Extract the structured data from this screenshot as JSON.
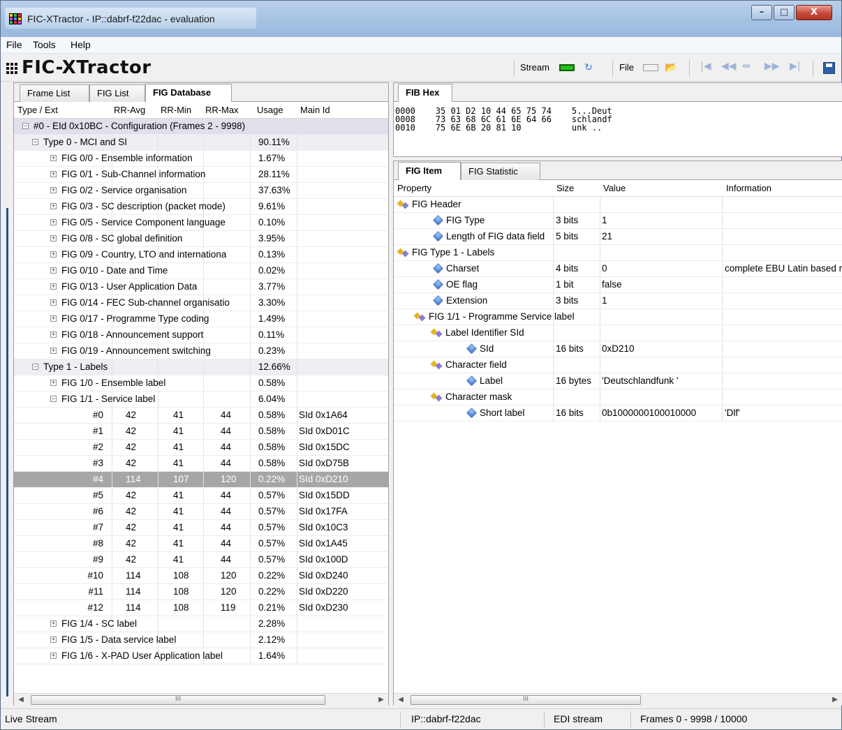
{
  "window": {
    "title": "FIC-XTractor - IP::dabrf-f22dac - evaluation"
  },
  "menu": [
    "File",
    "Tools",
    "Help"
  ],
  "toolbar": {
    "brand": "FIC-XTractor",
    "stream_label": "Stream",
    "file_label": "File"
  },
  "left_tabs": [
    "Frame List",
    "FIG List",
    "FIG Database"
  ],
  "left_columns": [
    "Type / Ext",
    "RR-Avg",
    "RR-Min",
    "RR-Max",
    "Usage",
    "Main Id"
  ],
  "left_rows": [
    {
      "indent": 0,
      "exp": "−",
      "label": "#0 - EId 0x10BC - Configuration (Frames 2 - 9998)",
      "avg": "",
      "min": "",
      "max": "",
      "usage": "",
      "main": "",
      "style": "group0"
    },
    {
      "indent": 1,
      "exp": "−",
      "label": "Type 0 - MCI and SI",
      "avg": "",
      "min": "",
      "max": "",
      "usage": "90.11%",
      "main": "",
      "style": "shaded"
    },
    {
      "indent": 2,
      "exp": "+",
      "label": "FIG 0/0 - Ensemble information",
      "avg": "",
      "min": "",
      "max": "",
      "usage": "1.67%",
      "main": ""
    },
    {
      "indent": 2,
      "exp": "+",
      "label": "FIG 0/1 - Sub-Channel information",
      "avg": "",
      "min": "",
      "max": "",
      "usage": "28.11%",
      "main": ""
    },
    {
      "indent": 2,
      "exp": "+",
      "label": "FIG 0/2 - Service organisation",
      "avg": "",
      "min": "",
      "max": "",
      "usage": "37.63%",
      "main": ""
    },
    {
      "indent": 2,
      "exp": "+",
      "label": "FIG 0/3 - SC description (packet mode)",
      "avg": "",
      "min": "",
      "max": "",
      "usage": "9.61%",
      "main": ""
    },
    {
      "indent": 2,
      "exp": "+",
      "label": "FIG 0/5 - Service Component language",
      "avg": "",
      "min": "",
      "max": "",
      "usage": "0.10%",
      "main": ""
    },
    {
      "indent": 2,
      "exp": "+",
      "label": "FIG 0/8 - SC global definition",
      "avg": "",
      "min": "",
      "max": "",
      "usage": "3.95%",
      "main": ""
    },
    {
      "indent": 2,
      "exp": "+",
      "label": "FIG 0/9 - Country, LTO and internationa",
      "avg": "",
      "min": "",
      "max": "",
      "usage": "0.13%",
      "main": ""
    },
    {
      "indent": 2,
      "exp": "+",
      "label": "FIG 0/10 - Date and Time",
      "avg": "",
      "min": "",
      "max": "",
      "usage": "0.02%",
      "main": ""
    },
    {
      "indent": 2,
      "exp": "+",
      "label": "FIG 0/13 - User Application Data",
      "avg": "",
      "min": "",
      "max": "",
      "usage": "3.77%",
      "main": ""
    },
    {
      "indent": 2,
      "exp": "+",
      "label": "FIG 0/14 - FEC Sub-channel organisatio",
      "avg": "",
      "min": "",
      "max": "",
      "usage": "3.30%",
      "main": ""
    },
    {
      "indent": 2,
      "exp": "+",
      "label": "FIG 0/17 - Programme Type coding",
      "avg": "",
      "min": "",
      "max": "",
      "usage": "1.49%",
      "main": ""
    },
    {
      "indent": 2,
      "exp": "+",
      "label": "FIG 0/18 - Announcement support",
      "avg": "",
      "min": "",
      "max": "",
      "usage": "0.11%",
      "main": ""
    },
    {
      "indent": 2,
      "exp": "+",
      "label": "FIG 0/19 - Announcement switching",
      "avg": "",
      "min": "",
      "max": "",
      "usage": "0.23%",
      "main": ""
    },
    {
      "indent": 1,
      "exp": "−",
      "label": "Type 1 - Labels",
      "avg": "",
      "min": "",
      "max": "",
      "usage": "12.66%",
      "main": "",
      "style": "shaded"
    },
    {
      "indent": 2,
      "exp": "+",
      "label": "FIG 1/0 - Ensemble label",
      "avg": "",
      "min": "",
      "max": "",
      "usage": "0.58%",
      "main": ""
    },
    {
      "indent": 2,
      "exp": "−",
      "label": "FIG 1/1 - Service label",
      "avg": "",
      "min": "",
      "max": "",
      "usage": "6.04%",
      "main": ""
    },
    {
      "indent": 3,
      "exp": "",
      "label": "#0",
      "avg": "42",
      "min": "41",
      "max": "44",
      "usage": "0.58%",
      "main": "SId 0x1A64"
    },
    {
      "indent": 3,
      "exp": "",
      "label": "#1",
      "avg": "42",
      "min": "41",
      "max": "44",
      "usage": "0.58%",
      "main": "SId 0xD01C"
    },
    {
      "indent": 3,
      "exp": "",
      "label": "#2",
      "avg": "42",
      "min": "41",
      "max": "44",
      "usage": "0.58%",
      "main": "SId 0x15DC"
    },
    {
      "indent": 3,
      "exp": "",
      "label": "#3",
      "avg": "42",
      "min": "41",
      "max": "44",
      "usage": "0.58%",
      "main": "SId 0xD75B"
    },
    {
      "indent": 3,
      "exp": "",
      "label": "#4",
      "avg": "114",
      "min": "107",
      "max": "120",
      "usage": "0.22%",
      "main": "SId 0xD210",
      "style": "selected"
    },
    {
      "indent": 3,
      "exp": "",
      "label": "#5",
      "avg": "42",
      "min": "41",
      "max": "44",
      "usage": "0.57%",
      "main": "SId 0x15DD"
    },
    {
      "indent": 3,
      "exp": "",
      "label": "#6",
      "avg": "42",
      "min": "41",
      "max": "44",
      "usage": "0.57%",
      "main": "SId 0x17FA"
    },
    {
      "indent": 3,
      "exp": "",
      "label": "#7",
      "avg": "42",
      "min": "41",
      "max": "44",
      "usage": "0.57%",
      "main": "SId 0x10C3"
    },
    {
      "indent": 3,
      "exp": "",
      "label": "#8",
      "avg": "42",
      "min": "41",
      "max": "44",
      "usage": "0.57%",
      "main": "SId 0x1A45"
    },
    {
      "indent": 3,
      "exp": "",
      "label": "#9",
      "avg": "42",
      "min": "41",
      "max": "44",
      "usage": "0.57%",
      "main": "SId 0x100D"
    },
    {
      "indent": 3,
      "exp": "",
      "label": "#10",
      "avg": "114",
      "min": "108",
      "max": "120",
      "usage": "0.22%",
      "main": "SId 0xD240"
    },
    {
      "indent": 3,
      "exp": "",
      "label": "#11",
      "avg": "114",
      "min": "108",
      "max": "120",
      "usage": "0.22%",
      "main": "SId 0xD220"
    },
    {
      "indent": 3,
      "exp": "",
      "label": "#12",
      "avg": "114",
      "min": "108",
      "max": "119",
      "usage": "0.21%",
      "main": "SId 0xD230"
    },
    {
      "indent": 2,
      "exp": "+",
      "label": "FIG 1/4 - SC label",
      "avg": "",
      "min": "",
      "max": "",
      "usage": "2.28%",
      "main": ""
    },
    {
      "indent": 2,
      "exp": "+",
      "label": "FIG 1/5 - Data service label",
      "avg": "",
      "min": "",
      "max": "",
      "usage": "2.12%",
      "main": ""
    },
    {
      "indent": 2,
      "exp": "+",
      "label": "FIG 1/6 - X-PAD User Application label",
      "avg": "",
      "min": "",
      "max": "",
      "usage": "1.64%",
      "main": ""
    }
  ],
  "fib_hex": {
    "tab": "FIB Hex",
    "text": "0000    35 01 D2 10 44 65 75 74    5...Deut\n0008    73 63 68 6C 61 6E 64 66    schlandf\n0010    75 6E 6B 20 81 10          unk .."
  },
  "right_tabs": [
    "FIG Item",
    "FIG Statistic"
  ],
  "right_columns": [
    "Property",
    "Size",
    "Value",
    "Information"
  ],
  "right_rows": [
    {
      "level": 0,
      "icon": "group",
      "prop": "FIG Header",
      "size": "",
      "value": "",
      "info": ""
    },
    {
      "level": 1,
      "icon": "leaf",
      "prop": "FIG Type",
      "size": "3 bits",
      "value": "1",
      "info": ""
    },
    {
      "level": 1,
      "icon": "leaf",
      "prop": "Length of FIG data field",
      "size": "5 bits",
      "value": "21",
      "info": ""
    },
    {
      "level": 0,
      "icon": "group",
      "prop": "FIG Type 1 - Labels",
      "size": "",
      "value": "",
      "info": ""
    },
    {
      "level": 1,
      "icon": "leaf",
      "prop": "Charset",
      "size": "4 bits",
      "value": "0",
      "info": "complete EBU Latin based r"
    },
    {
      "level": 1,
      "icon": "leaf",
      "prop": "OE flag",
      "size": "1 bit",
      "value": "false",
      "info": ""
    },
    {
      "level": 1,
      "icon": "leaf",
      "prop": "Extension",
      "size": "3 bits",
      "value": "1",
      "info": ""
    },
    {
      "level": 1,
      "icon": "group",
      "prop": "FIG 1/1 - Programme Service label",
      "size": "",
      "value": "",
      "info": ""
    },
    {
      "level": 2,
      "icon": "group",
      "prop": "Label Identifier SId",
      "size": "",
      "value": "",
      "info": ""
    },
    {
      "level": 3,
      "icon": "leaf",
      "prop": "SId",
      "size": "16 bits",
      "value": "0xD210",
      "info": ""
    },
    {
      "level": 2,
      "icon": "group",
      "prop": "Character field",
      "size": "",
      "value": "",
      "info": ""
    },
    {
      "level": 3,
      "icon": "leaf",
      "prop": "Label",
      "size": "16 bytes",
      "value": "'Deutschlandfunk '",
      "info": ""
    },
    {
      "level": 2,
      "icon": "group",
      "prop": "Character mask",
      "size": "",
      "value": "",
      "info": ""
    },
    {
      "level": 3,
      "icon": "leaf",
      "prop": "Short label",
      "size": "16 bits",
      "value": "0b1000000100010000",
      "info": "'Dlf'"
    }
  ],
  "scroll_thumb": "III",
  "status": {
    "left": "Live Stream",
    "host": "IP::dabrf-f22dac",
    "mode": "EDI stream",
    "frames": "Frames 0 - 9998 / 10000"
  }
}
